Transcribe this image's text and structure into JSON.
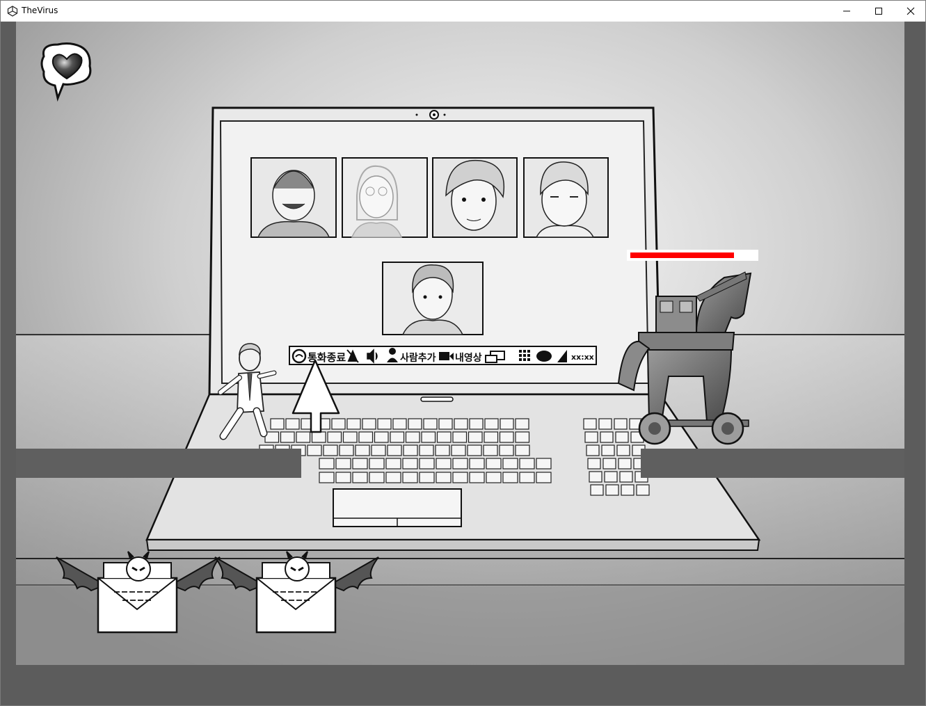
{
  "window": {
    "title": "TheVirus",
    "controls": [
      "minimize-icon",
      "maximize-icon",
      "close-icon"
    ]
  },
  "hud": {
    "icon": "broken-heart-speech-bubble-icon",
    "boss_health_fraction": 0.83
  },
  "video_call": {
    "participants": 5,
    "toolbar_labels": {
      "end_call": "통화종료",
      "add_person": "사람추가",
      "my_video": "내영상",
      "time": "xx:xx"
    }
  },
  "entities": {
    "player": "office-worker-player",
    "boss": "trojan-horse-boss",
    "enemies": [
      "devil-mail-enemy",
      "devil-mail-enemy"
    ],
    "cursor": "mouse-cursor-arrow"
  },
  "colors": {
    "health": "#ff0000",
    "health_bg": "#ffffff",
    "platform": "#5f5f5f",
    "frame": "#5c5c5c"
  }
}
